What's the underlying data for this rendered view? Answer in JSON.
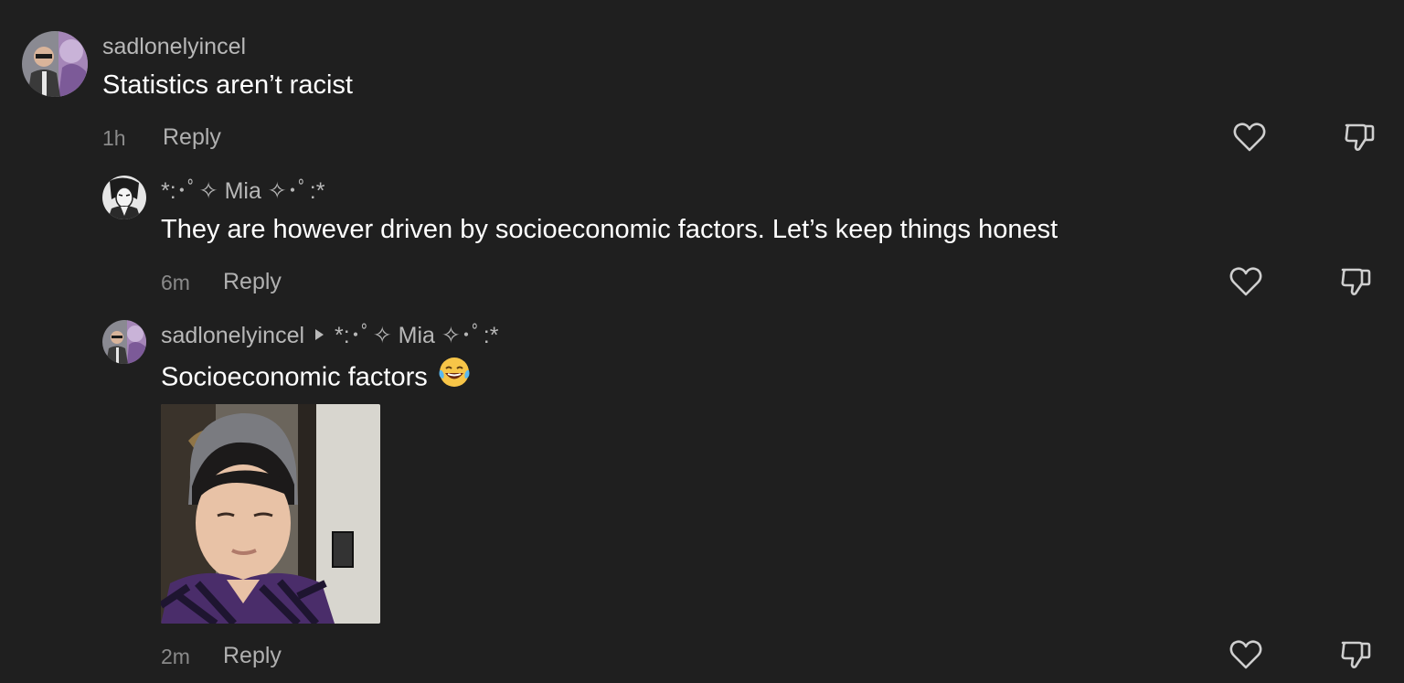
{
  "comments": [
    {
      "username": "sadlonelyincel",
      "text": "Statistics aren’t racist",
      "time": "1h",
      "reply_label": "Reply"
    },
    {
      "username": "*:･ﾟ✧ Mia ✧･ﾟ:*",
      "text": "They are however driven by socioeconomic factors. Let’s keep things honest",
      "time": "6m",
      "reply_label": "Reply"
    },
    {
      "username": "sadlonelyincel",
      "reply_to": "*:･ﾟ✧ Mia ✧･ﾟ:*",
      "text": "Socioeconomic factors",
      "emoji": "😂",
      "time": "2m",
      "reply_label": "Reply",
      "attachment": "photo"
    }
  ],
  "icons": {
    "like": "heart-icon",
    "dislike": "thumbs-down-icon"
  },
  "colors": {
    "background": "#1f1f1f",
    "text": "#ffffff",
    "username": "#b8b8b8",
    "muted": "#8a8a8a"
  }
}
